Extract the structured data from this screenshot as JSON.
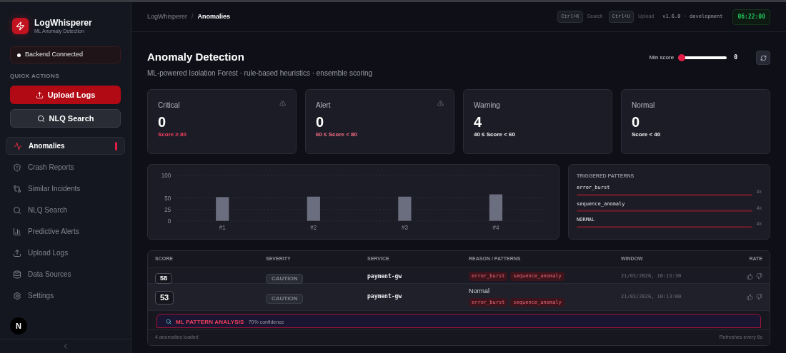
{
  "sidebar": {
    "app_name": "LogWhisperer",
    "app_subtitle": "ML Anomaly Detection",
    "status": {
      "label": "Backend Connected",
      "connected": true
    },
    "quick_actions_heading": "QUICK ACTIONS",
    "quick_actions": [
      {
        "label": "Upload Logs",
        "kind": "upload",
        "primary": true
      },
      {
        "label": "NLQ Search",
        "kind": "search",
        "primary": false
      }
    ],
    "nav": [
      {
        "label": "Anomalies",
        "kind": "activity",
        "selected": true
      },
      {
        "label": "Crash Reports",
        "kind": "shield",
        "selected": false
      },
      {
        "label": "Similar Incidents",
        "kind": "merge",
        "selected": false
      },
      {
        "label": "NLQ Search",
        "kind": "search",
        "selected": false
      },
      {
        "label": "Predictive Alerts",
        "kind": "chart",
        "selected": false
      },
      {
        "label": "Upload Logs",
        "kind": "upload",
        "selected": false
      },
      {
        "label": "Data Sources",
        "kind": "database",
        "selected": false
      },
      {
        "label": "Settings",
        "kind": "settings",
        "selected": false
      }
    ],
    "avatar": "N"
  },
  "header": {
    "breadcrumbs": [
      "LogWhisperer",
      "Anomalies"
    ],
    "separator": "/",
    "shortcuts": [
      {
        "key": "Ctrl+K",
        "label": "Search"
      },
      {
        "key": "Ctrl+U",
        "label": "Upload"
      }
    ],
    "version": "v1.6.0 · development",
    "clock": "06:22:00"
  },
  "page": {
    "title": "Anomaly Detection",
    "subtitle": "ML-powered Isolation Forest · rule-based heuristics · ensemble scoring",
    "min_score": {
      "label": "Min score",
      "level": 0,
      "reading": "0"
    }
  },
  "cards": [
    {
      "title": "Critical",
      "value": "0",
      "range": "Score ≥ 80",
      "warning_icon": true,
      "color": "#f43f5e"
    },
    {
      "title": "Alert",
      "value": "0",
      "range": "60 ≤ Score < 80",
      "warning_icon": true,
      "color": "#fb7185"
    },
    {
      "title": "Warning",
      "value": "4",
      "range": "40 ≤ Score < 60",
      "warning_icon": false,
      "color": "#f3f4f6"
    },
    {
      "title": "Normal",
      "value": "0",
      "range": "Score < 40",
      "warning_icon": false,
      "color": "#f3f4f6"
    }
  ],
  "chart_data": {
    "type": "bar",
    "categories": [
      "#1",
      "#2",
      "#3",
      "#4"
    ],
    "values": [
      52,
      53,
      53,
      58
    ],
    "ylim": [
      0,
      100
    ],
    "yticks": [
      0,
      25,
      50,
      100
    ]
  },
  "patterns": {
    "title": "TRIGGERED PATTERNS",
    "items": [
      {
        "name": "error_burst",
        "count": "4x",
        "level": 1
      },
      {
        "name": "sequence_anomaly",
        "count": "4x",
        "level": 1
      },
      {
        "name": "NORMAL",
        "count": "4x",
        "level": 1
      }
    ]
  },
  "table": {
    "columns": [
      "SCORE",
      "SEVERITY",
      "SERVICE",
      "REASON / PATTERNS",
      "WINDOW",
      "RATE"
    ],
    "rows": [
      {
        "score": "58",
        "severity": "CAUTION",
        "service": "payment-gw",
        "patterns": [
          "error_burst",
          "sequence_anomaly"
        ],
        "window": "21/03/2026, 10:15:30"
      },
      {
        "score": "53",
        "severity": "CAUTION",
        "service": "payment-gw",
        "reason": "Normal",
        "patterns": [
          "error_burst",
          "sequence_anomaly"
        ],
        "window": "21/03/2026, 10:13:00"
      }
    ],
    "analysis": {
      "title": "ML PATTERN ANALYSIS",
      "confidence": "70% confidence"
    },
    "footer_left": "4 anomalies loaded",
    "footer_right": "Refreshes every 6s"
  }
}
